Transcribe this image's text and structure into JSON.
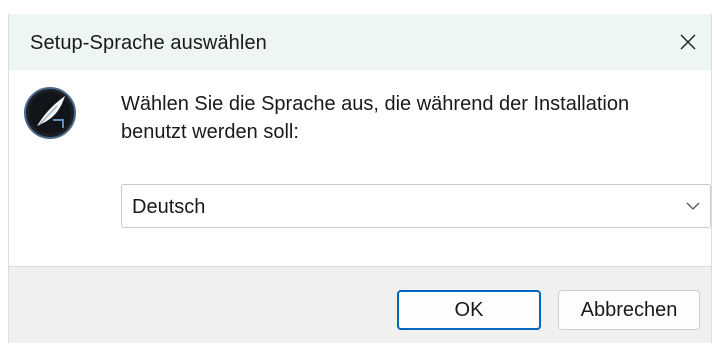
{
  "window": {
    "title": "Setup-Sprache auswählen",
    "close_icon": "close-icon"
  },
  "content": {
    "app_icon": "feather-pen-icon",
    "prompt": "Wählen Sie die Sprache aus, die während der Installation benutzt werden soll:",
    "language_select": {
      "selected": "Deutsch",
      "arrow_icon": "chevron-down-icon"
    }
  },
  "buttons": {
    "ok_label": "OK",
    "cancel_label": "Abbrechen"
  },
  "colors": {
    "titlebar_bg": "#eef6f4",
    "footer_bg": "#f0f0f0",
    "default_button_border": "#0067c0"
  }
}
